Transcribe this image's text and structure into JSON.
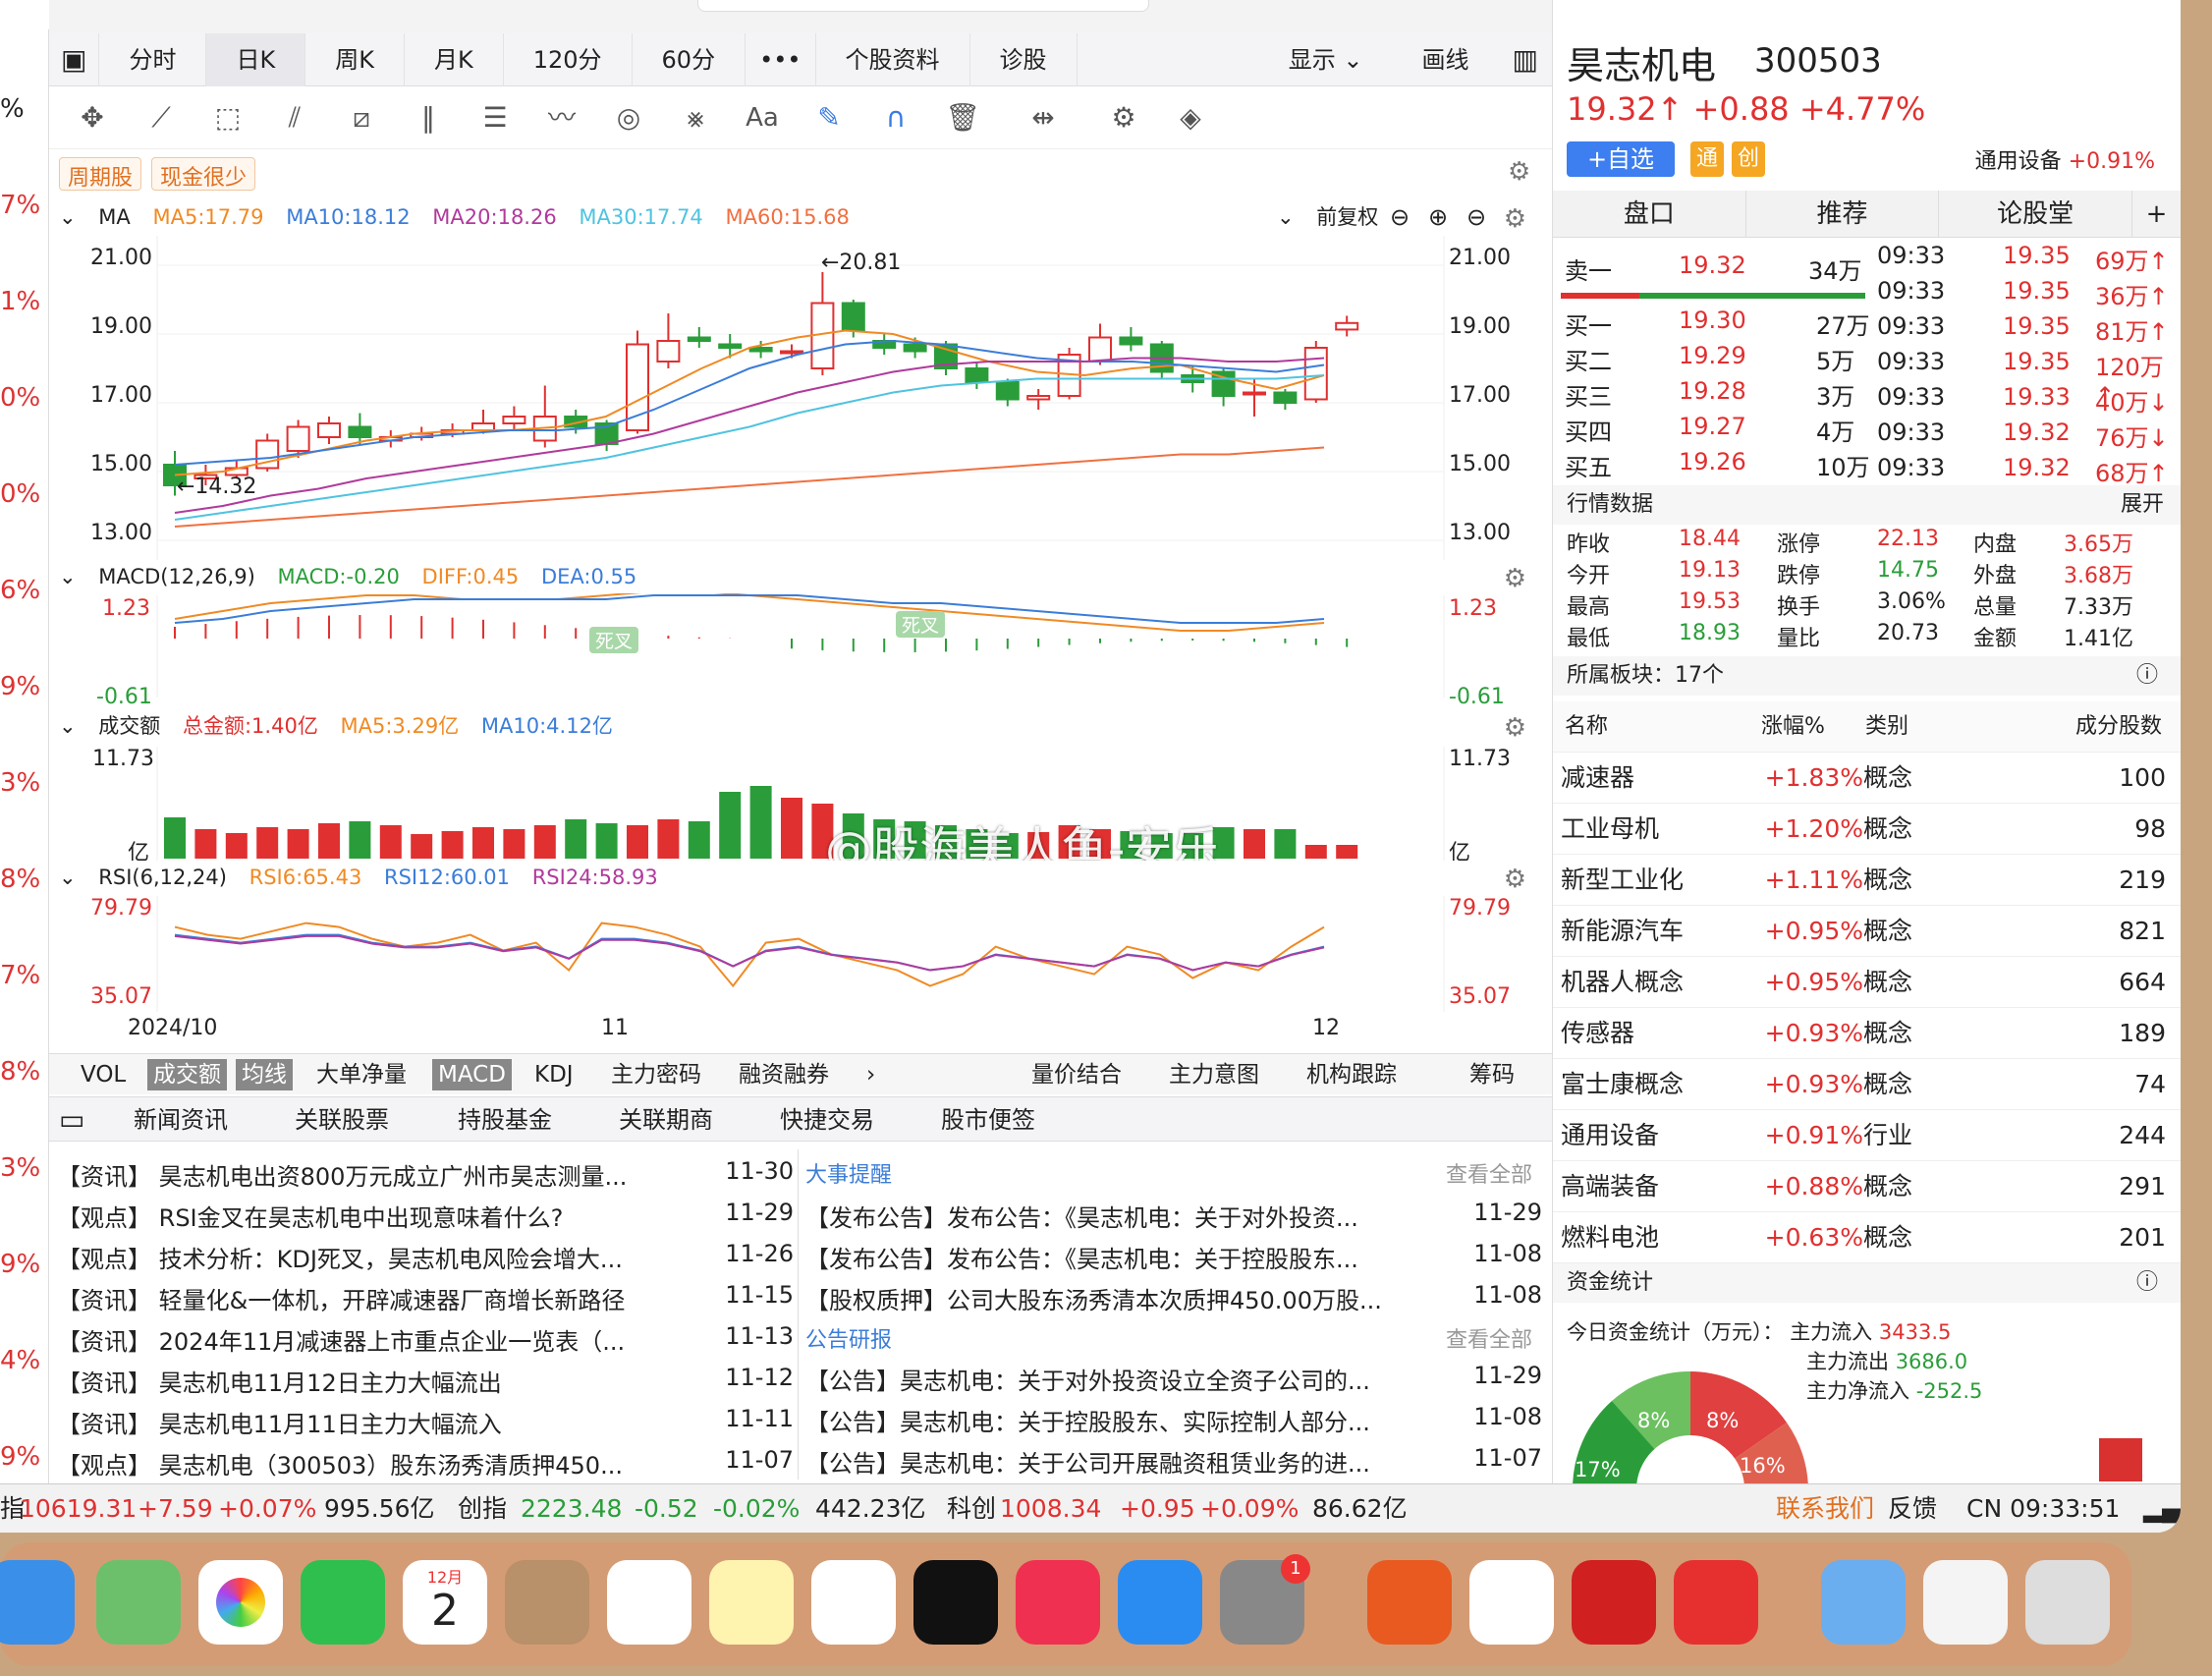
{
  "left_strip": {
    "values": [
      "%",
      "7%",
      "1%",
      "0%",
      "0%",
      "6%",
      "9%",
      "3%",
      "8%",
      "7%",
      "8%",
      "3%",
      "9%",
      "4%",
      "9%"
    ]
  },
  "tabs": [
    "分时",
    "日K",
    "周K",
    "月K",
    "120分",
    "60分",
    "•••",
    "个股资料",
    "诊股"
  ],
  "tabs_right": {
    "display": "显示",
    "draw": "画线"
  },
  "tags": [
    "周期股",
    "现金很少"
  ],
  "ma_header": {
    "label": "MA",
    "ma5": "MA5:17.79",
    "ma10": "MA10:18.12",
    "ma20": "MA20:18.26",
    "ma30": "MA30:17.74",
    "ma60": "MA60:15.68",
    "adjust": "前复权"
  },
  "colors": {
    "ma5": "#f08a24",
    "ma10": "#3b7dd8",
    "ma20": "#b03a9c",
    "ma30": "#4fc3e0",
    "ma60": "#f07040",
    "up": "#e03030",
    "down": "#2a9d3a"
  },
  "price_axis": [
    "21.00",
    "19.00",
    "17.00",
    "15.00",
    "13.00"
  ],
  "annotations": {
    "high": "←20.81",
    "low": "←14.32"
  },
  "macd_header": {
    "label": "MACD(12,26,9)",
    "macd": "MACD:-0.20",
    "diff": "DIFF:0.45",
    "dea": "DEA:0.55",
    "top": "1.23",
    "bottom": "-0.61",
    "cross1": "死叉",
    "cross2": "死叉"
  },
  "vol_header": {
    "label": "成交额",
    "total": "总金额:1.40亿",
    "ma5": "MA5:3.29亿",
    "ma10": "MA10:4.12亿",
    "top": "11.73",
    "unit": "亿"
  },
  "rsi_header": {
    "label": "RSI(6,12,24)",
    "rsi6": "RSI6:65.43",
    "rsi12": "RSI12:60.01",
    "rsi24": "RSI24:58.93",
    "top": "79.79",
    "bottom": "35.07"
  },
  "x_labels": [
    "2024/10",
    "11",
    "12"
  ],
  "watermark": "@股海美人鱼-安乐",
  "indicator_tabs": [
    "VOL",
    "成交额",
    "均线",
    "大单净量",
    "MACD",
    "KDJ",
    "主力密码",
    "融资融券",
    "›"
  ],
  "indicator_tabs_right": [
    "量价结合",
    "主力意图",
    "机构跟踪",
    "筹码"
  ],
  "news_tabs": [
    "新闻资讯",
    "关联股票",
    "持股基金",
    "关联期商",
    "快捷交易",
    "股市便签"
  ],
  "news": [
    {
      "tag": "【资讯】",
      "title": "昊志机电出资800万元成立广州市昊志测量...",
      "date": "11-30"
    },
    {
      "tag": "【观点】",
      "title": "RSI金叉在昊志机电中出现意味着什么?",
      "date": "11-29"
    },
    {
      "tag": "【观点】",
      "title": "技术分析：KDJ死叉，昊志机电风险会增大...",
      "date": "11-26"
    },
    {
      "tag": "【资讯】",
      "title": "轻量化&一体机，开辟减速器厂商增长新路径",
      "date": "11-15"
    },
    {
      "tag": "【资讯】",
      "title": "2024年11月减速器上市重点企业一览表（...",
      "date": "11-13"
    },
    {
      "tag": "【资讯】",
      "title": "昊志机电11月12日主力大幅流出",
      "date": "11-12"
    },
    {
      "tag": "【资讯】",
      "title": "昊志机电11月11日主力大幅流入",
      "date": "11-11"
    },
    {
      "tag": "【观点】",
      "title": "昊志机电（300503）股东汤秀清质押450...",
      "date": "11-07"
    }
  ],
  "events": {
    "title": "大事提醒",
    "more": "查看全部",
    "items": [
      {
        "tag": "【发布公告】",
        "title": "发布公告：《昊志机电：关于对外投资...",
        "date": "11-29"
      },
      {
        "tag": "【发布公告】",
        "title": "发布公告：《昊志机电：关于控股股东...",
        "date": "11-08"
      },
      {
        "tag": "【股权质押】",
        "title": "公司大股东汤秀清本次质押450.00万股...",
        "date": "11-08"
      }
    ]
  },
  "notices": {
    "title": "公告研报",
    "more": "查看全部",
    "items": [
      {
        "tag": "【公告】",
        "title": "昊志机电：关于对外投资设立全资子公司的...",
        "date": "11-29"
      },
      {
        "tag": "【公告】",
        "title": "昊志机电：关于控股股东、实际控制人部分...",
        "date": "11-08"
      },
      {
        "tag": "【公告】",
        "title": "昊志机电：关于公司开展融资租赁业务的进...",
        "date": "11-07"
      }
    ]
  },
  "stock": {
    "name": "昊志机电",
    "code": "300503",
    "price": "19.32↑",
    "change": "+0.88",
    "pct": "+4.77%",
    "add": "+自选",
    "b1": "通",
    "b2": "创",
    "sector": "通用设备",
    "sector_pct": "+0.91%"
  },
  "side_tabs": [
    "盘口",
    "推荐",
    "论股堂",
    "+"
  ],
  "sell": {
    "label": "卖一",
    "price": "19.32",
    "vol": "34万"
  },
  "buys": [
    {
      "label": "买一",
      "price": "19.30",
      "vol": "27万"
    },
    {
      "label": "买二",
      "price": "19.29",
      "vol": "5万"
    },
    {
      "label": "买三",
      "price": "19.28",
      "vol": "3万"
    },
    {
      "label": "买四",
      "price": "19.27",
      "vol": "4万"
    },
    {
      "label": "买五",
      "price": "19.26",
      "vol": "10万"
    }
  ],
  "ticks": [
    {
      "t": "09:33",
      "p": "19.35",
      "v": "69万↑"
    },
    {
      "t": "09:33",
      "p": "19.35",
      "v": "36万↑"
    },
    {
      "t": "09:33",
      "p": "19.35",
      "v": "81万↑"
    },
    {
      "t": "09:33",
      "p": "19.35",
      "v": "120万↑"
    },
    {
      "t": "09:33",
      "p": "19.33",
      "v": "40万↓"
    },
    {
      "t": "09:33",
      "p": "19.32",
      "v": "76万↓"
    },
    {
      "t": "09:33",
      "p": "19.32",
      "v": "68万↑"
    }
  ],
  "quote_header": {
    "title": "行情数据",
    "expand": "展开"
  },
  "quote": [
    [
      "昨收",
      "18.44",
      "涨停",
      "22.13",
      "内盘",
      "3.65万"
    ],
    [
      "今开",
      "19.13",
      "跌停",
      "14.75",
      "外盘",
      "3.68万"
    ],
    [
      "最高",
      "19.53",
      "换手",
      "3.06%",
      "总量",
      "7.33万"
    ],
    [
      "最低",
      "18.93",
      "量比",
      "20.73",
      "金额",
      "1.41亿"
    ]
  ],
  "boards_header": {
    "title": "所属板块：17个"
  },
  "boards_cols": [
    "名称",
    "涨幅%",
    "类别",
    "成分股数"
  ],
  "boards": [
    {
      "n": "减速器",
      "p": "+1.83%",
      "c": "概念",
      "k": "100"
    },
    {
      "n": "工业母机",
      "p": "+1.20%",
      "c": "概念",
      "k": "98"
    },
    {
      "n": "新型工业化",
      "p": "+1.11%",
      "c": "概念",
      "k": "219"
    },
    {
      "n": "新能源汽车",
      "p": "+0.95%",
      "c": "概念",
      "k": "821"
    },
    {
      "n": "机器人概念",
      "p": "+0.95%",
      "c": "概念",
      "k": "664"
    },
    {
      "n": "传感器",
      "p": "+0.93%",
      "c": "概念",
      "k": "189"
    },
    {
      "n": "富士康概念",
      "p": "+0.93%",
      "c": "概念",
      "k": "74"
    },
    {
      "n": "通用设备",
      "p": "+0.91%",
      "c": "行业",
      "k": "244"
    },
    {
      "n": "高端装备",
      "p": "+0.88%",
      "c": "概念",
      "k": "291"
    },
    {
      "n": "燃料电池",
      "p": "+0.63%",
      "c": "概念",
      "k": "201"
    }
  ],
  "funds": {
    "title": "资金统计",
    "today": "今日资金统计（万元）：",
    "in_label": "主力流入",
    "in": "3433.5",
    "out_label": "主力流出",
    "out": "3686.0",
    "net_label": "主力净流入",
    "net": "-252.5",
    "p1": "8%",
    "p2": "8%",
    "p3": "16%",
    "p4": "17%"
  },
  "status": {
    "idx1": "10619.31",
    "c1": "+7.59",
    "p1": "+0.07%",
    "a1": "995.56亿",
    "n2": "创指",
    "idx2": "2223.48",
    "c2": "-0.52",
    "p2": "-0.02%",
    "a2": "442.23亿",
    "n3": "科创",
    "idx3": "1008.34",
    "c3": "+0.95",
    "p3": "+0.09%",
    "a3": "86.62亿",
    "contact": "联系我们",
    "feedback": "反馈",
    "clock": "CN 09:33:51",
    "prefix": "指"
  },
  "dock": {
    "cal_month": "12月",
    "cal_day": "2",
    "badge": "1"
  }
}
